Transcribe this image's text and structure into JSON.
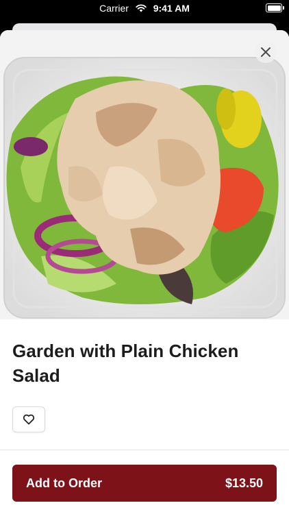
{
  "status_bar": {
    "carrier": "Carrier",
    "time": "9:41 AM"
  },
  "product": {
    "title": "Garden with Plain Chicken Salad"
  },
  "order_button": {
    "label": "Add to Order",
    "price": "$13.50"
  },
  "icons": {
    "close": "close-icon",
    "favorite": "heart-outline-icon",
    "wifi": "wifi-icon",
    "battery": "battery-icon"
  },
  "colors": {
    "accent": "#7d1219"
  }
}
